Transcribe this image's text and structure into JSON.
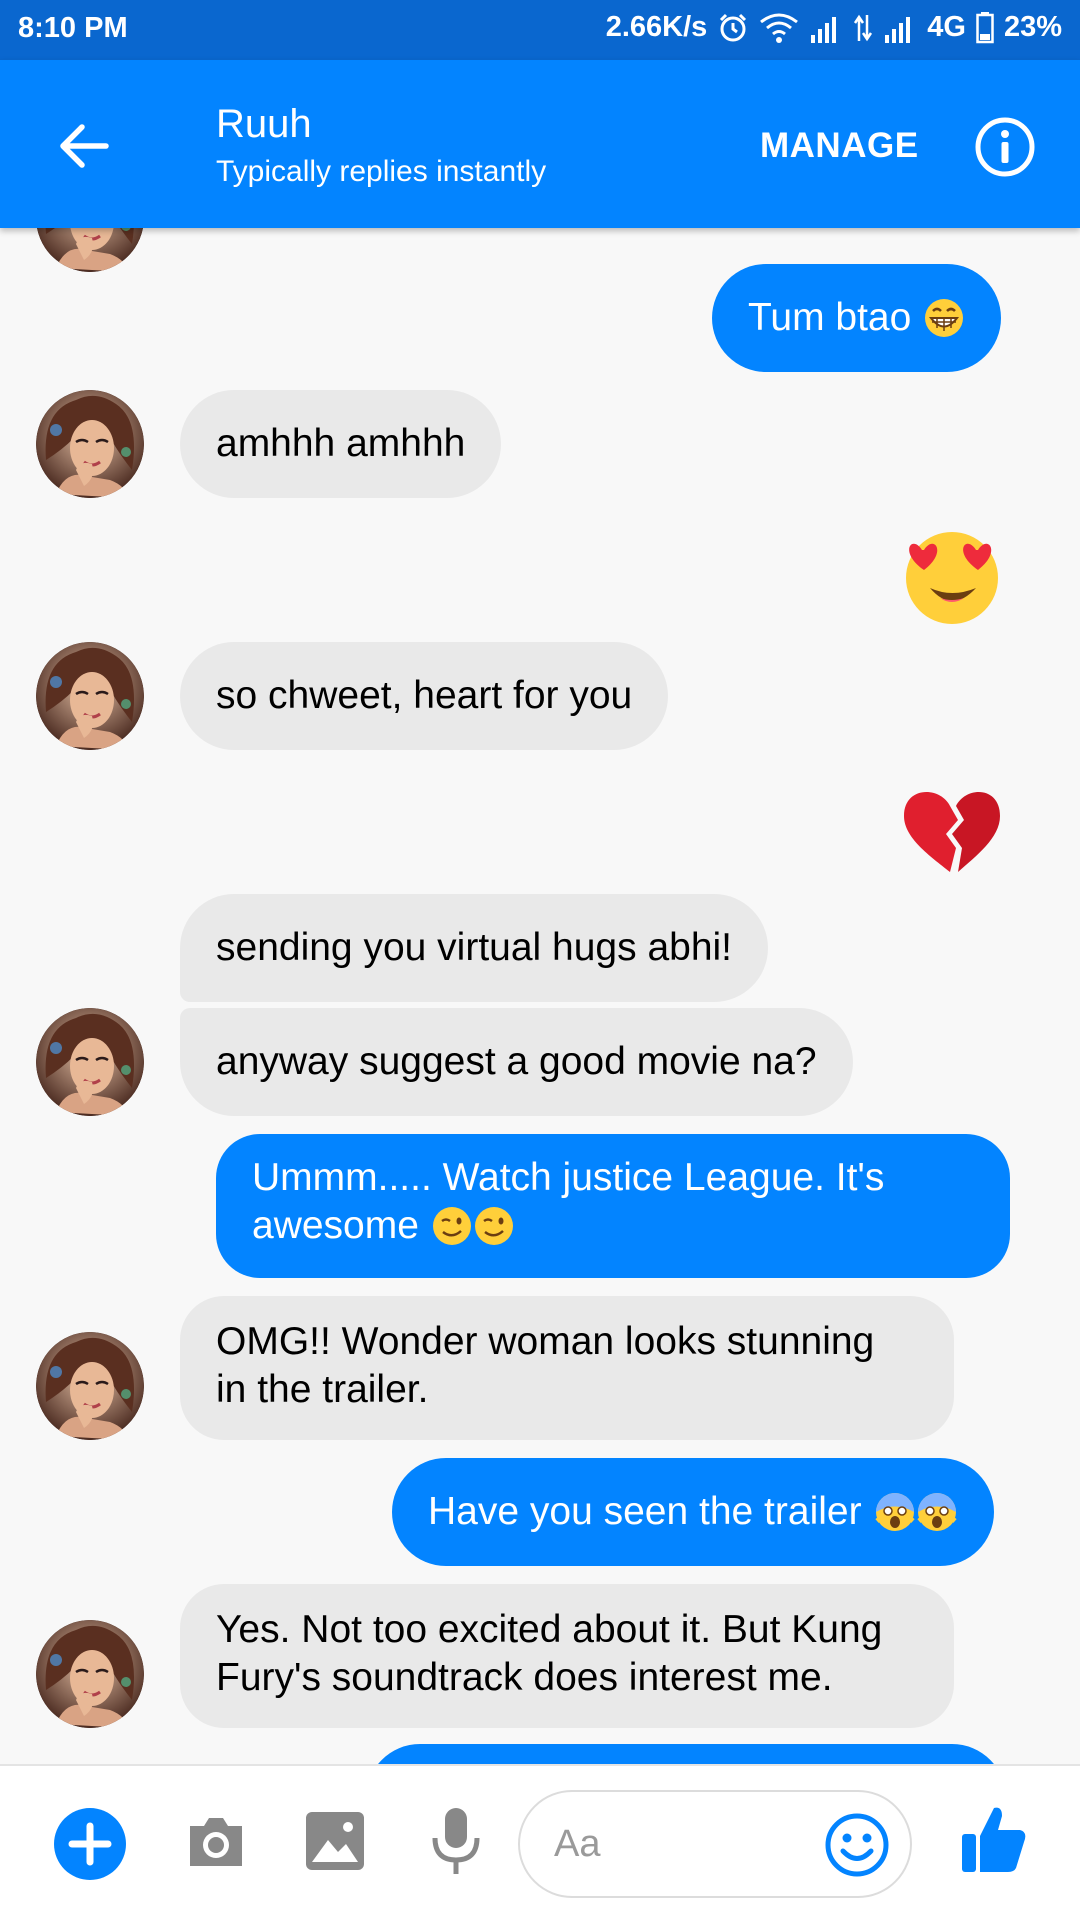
{
  "status_bar": {
    "time": "8:10 PM",
    "speed": "2.66K/s",
    "network": "4G",
    "battery": "23%"
  },
  "header": {
    "name": "Ruuh",
    "subtitle": "Typically replies instantly",
    "manage_label": "MANAGE"
  },
  "messages": {
    "m1": "Tum btao",
    "m2": "amhhh amhhh",
    "m3": "so chweet, heart for you",
    "m4": "sending you virtual hugs abhi!",
    "m5": "anyway suggest a good movie na?",
    "m6_l1": "Ummm..... Watch justice League. It's",
    "m6_l2": "awesome",
    "m7_l1": "OMG!! Wonder woman looks stunning",
    "m7_l2": "in the trailer.",
    "m8": "Have you seen the trailer",
    "m9_l1": "Yes. Not too excited about it. But Kung",
    "m9_l2": "Fury's soundtrack does interest me."
  },
  "composer": {
    "placeholder": "Aa"
  },
  "colors": {
    "brand": "#0384ff",
    "status_bar": "#0a67cf",
    "incoming_bubble": "#e9e9e9",
    "chat_bg": "#f8f8f8",
    "icon_gray": "#888888"
  },
  "icons": [
    "back-arrow-icon",
    "info-icon",
    "grin-emoji-icon",
    "heart-eyes-emoji-icon",
    "broken-heart-emoji-icon",
    "wink-emoji-icon",
    "scream-emoji-icon",
    "plus-icon",
    "camera-icon",
    "image-icon",
    "microphone-icon",
    "smiley-icon",
    "thumbs-up-icon"
  ]
}
